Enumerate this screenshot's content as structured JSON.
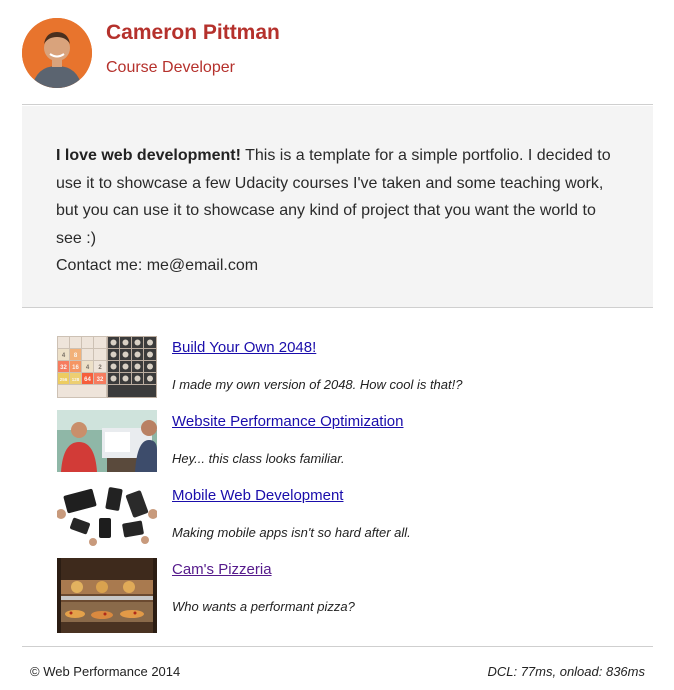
{
  "header": {
    "name": "Cameron Pittman",
    "role": "Course Developer"
  },
  "intro": {
    "bold": "I love web development!",
    "text": " This is a template for a simple portfolio. I decided to use it to showcase a few Udacity courses I've taken and some teaching work, but you can use it to showcase any kind of project that you want the world to see :)",
    "contact": "Contact me: me@email.com"
  },
  "projects": [
    {
      "title": "Build Your Own 2048!",
      "description": "I made my own version of 2048. How cool is that!?",
      "tiles": [
        "4",
        "8",
        "32",
        "16",
        "4",
        "2",
        "256",
        "128",
        "64",
        "32"
      ]
    },
    {
      "title": "Website Performance Optimization",
      "description": "Hey... this class looks familiar."
    },
    {
      "title": "Mobile Web Development",
      "description": "Making mobile apps isn't so hard after all."
    },
    {
      "title": "Cam's Pizzeria",
      "description": "Who wants a performant pizza?"
    }
  ],
  "footer": {
    "copyright": "© Web Performance 2014",
    "perf": "DCL: 77ms, onload: 836ms"
  },
  "colors": {
    "accent": "#b5312c",
    "link": "#1a0dab",
    "visited_link": "#551a8b",
    "intro_background": "#f4f4f4"
  }
}
